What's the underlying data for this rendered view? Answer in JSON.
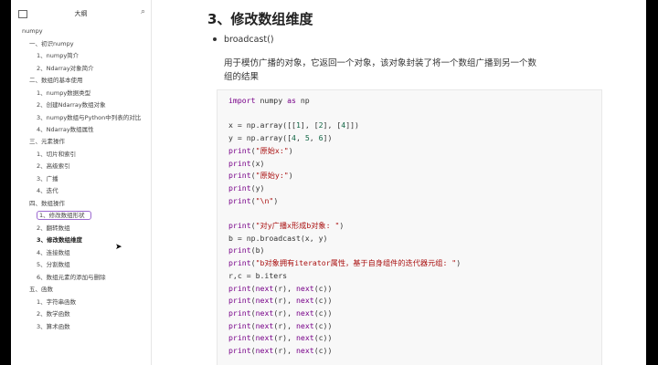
{
  "sidebar": {
    "title": "大纲",
    "items": [
      {
        "label": "numpy",
        "level": 0
      },
      {
        "label": "一、初识numpy",
        "level": 1
      },
      {
        "label": "1、numpy简介",
        "level": 2
      },
      {
        "label": "2、Ndarray对象简介",
        "level": 2
      },
      {
        "label": "二、数组的基本使用",
        "level": 1
      },
      {
        "label": "1、numpy数据类型",
        "level": 2
      },
      {
        "label": "2、创建Ndarray数组对象",
        "level": 2
      },
      {
        "label": "3、numpy数组与Python中列表的对比",
        "level": 2
      },
      {
        "label": "4、Ndarray数组属性",
        "level": 2
      },
      {
        "label": "三、元素操作",
        "level": 1
      },
      {
        "label": "1、切片和索引",
        "level": 2
      },
      {
        "label": "2、高级索引",
        "level": 2
      },
      {
        "label": "3、广播",
        "level": 2
      },
      {
        "label": "4、迭代",
        "level": 2
      },
      {
        "label": "四、数组操作",
        "level": 1
      },
      {
        "label": "1、修改数组形状",
        "level": 2
      },
      {
        "label": "2、翻转数组",
        "level": 2
      },
      {
        "label": "3、修改数组维度",
        "level": 2
      },
      {
        "label": "4、连接数组",
        "level": 2
      },
      {
        "label": "5、分割数组",
        "level": 2
      },
      {
        "label": "6、数组元素的添加与删除",
        "level": 2
      },
      {
        "label": "五、函数",
        "level": 1
      },
      {
        "label": "1、字符串函数",
        "level": 2
      },
      {
        "label": "2、数学函数",
        "level": 2
      },
      {
        "label": "3、算术函数",
        "level": 2
      }
    ]
  },
  "content": {
    "heading": "3、修改数组维度",
    "bullet": "broadcast()",
    "description": "用于模仿广播的对象，它返回一个对象，该对象封装了将一个数组广播到另一个数组的结果"
  },
  "code_lines": [
    "import numpy as np",
    "",
    "x = np.array([[1], [2], [4]])",
    "y = np.array([4, 5, 6])",
    "print(\"原始x:\")",
    "print(x)",
    "print(\"原始y:\")",
    "print(y)",
    "print(\"\\n\")",
    "",
    "print(\"对y广播x形成b对象: \")",
    "b = np.broadcast(x, y)",
    "print(b)",
    "print(\"b对象拥有iterator属性，基于自身组件的迭代器元组: \")",
    "r,c = b.iters",
    "print(next(r), next(c))",
    "print(next(r), next(c))",
    "print(next(r), next(c))",
    "print(next(r), next(c))",
    "print(next(r), next(c))",
    "print(next(r), next(c))"
  ],
  "colors": {
    "keyword": "#770088",
    "string": "#aa1111",
    "number": "#116644",
    "active_outline": "#9c6ad0"
  }
}
